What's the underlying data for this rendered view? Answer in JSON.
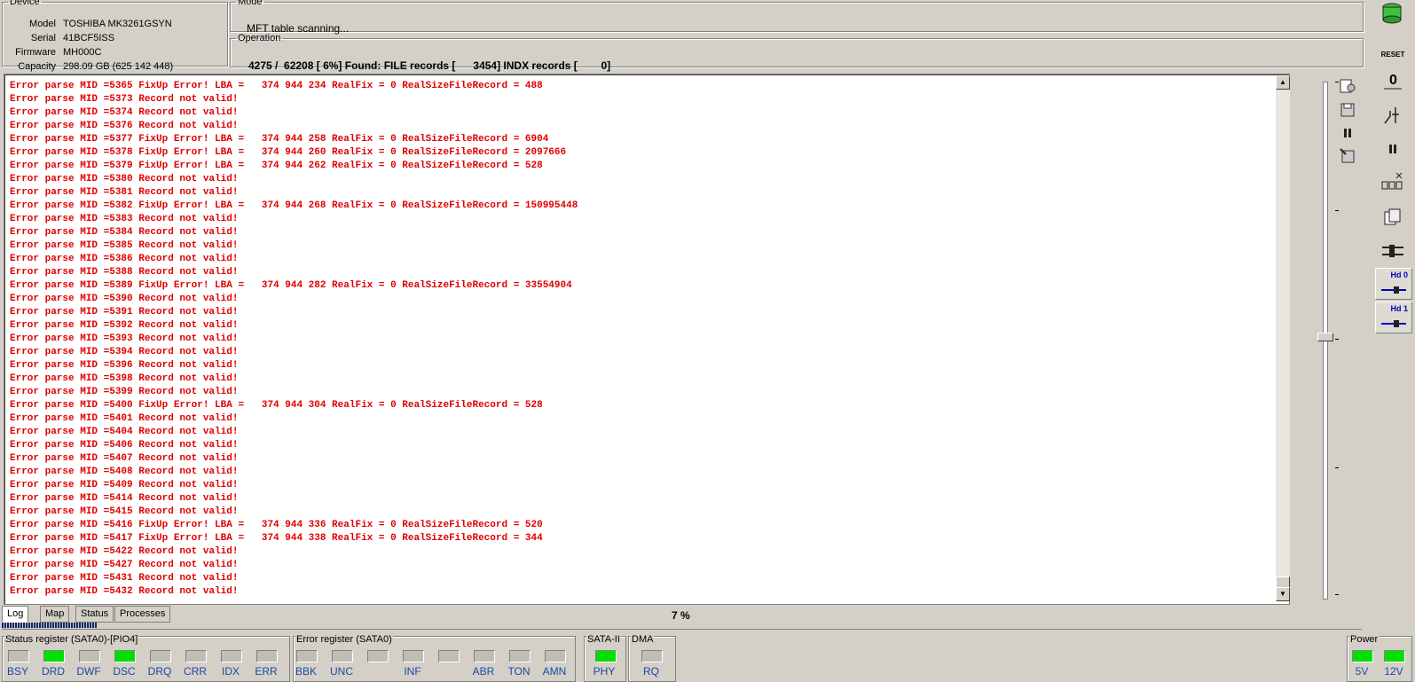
{
  "device": {
    "legend": "Device",
    "rows": [
      {
        "key": "Model",
        "value": "TOSHIBA MK3261GSYN"
      },
      {
        "key": "Serial",
        "value": "41BCF5ISS"
      },
      {
        "key": "Firmware",
        "value": "MH000C"
      },
      {
        "key": "Capacity",
        "value": "298.09 GB (625 142 448)"
      }
    ]
  },
  "mode": {
    "legend": "Mode",
    "text": "MFT table scanning..."
  },
  "operation": {
    "legend": "Operation",
    "text": "4275 /  62208 [ 6%] Found: FILE records [      3454] INDX records [        0]"
  },
  "log": [
    "Error parse MID =5365 FixUp Error! LBA =   374 944 234 RealFix = 0 RealSizeFileRecord = 488",
    "Error parse MID =5373 Record not valid!",
    "Error parse MID =5374 Record not valid!",
    "Error parse MID =5376 Record not valid!",
    "Error parse MID =5377 FixUp Error! LBA =   374 944 258 RealFix = 0 RealSizeFileRecord = 6904",
    "Error parse MID =5378 FixUp Error! LBA =   374 944 260 RealFix = 0 RealSizeFileRecord = 2097666",
    "Error parse MID =5379 FixUp Error! LBA =   374 944 262 RealFix = 0 RealSizeFileRecord = 528",
    "Error parse MID =5380 Record not valid!",
    "Error parse MID =5381 Record not valid!",
    "Error parse MID =5382 FixUp Error! LBA =   374 944 268 RealFix = 0 RealSizeFileRecord = 150995448",
    "Error parse MID =5383 Record not valid!",
    "Error parse MID =5384 Record not valid!",
    "Error parse MID =5385 Record not valid!",
    "Error parse MID =5386 Record not valid!",
    "Error parse MID =5388 Record not valid!",
    "Error parse MID =5389 FixUp Error! LBA =   374 944 282 RealFix = 0 RealSizeFileRecord = 33554904",
    "Error parse MID =5390 Record not valid!",
    "Error parse MID =5391 Record not valid!",
    "Error parse MID =5392 Record not valid!",
    "Error parse MID =5393 Record not valid!",
    "Error parse MID =5394 Record not valid!",
    "Error parse MID =5396 Record not valid!",
    "Error parse MID =5398 Record not valid!",
    "Error parse MID =5399 Record not valid!",
    "Error parse MID =5400 FixUp Error! LBA =   374 944 304 RealFix = 0 RealSizeFileRecord = 528",
    "Error parse MID =5401 Record not valid!",
    "Error parse MID =5404 Record not valid!",
    "Error parse MID =5406 Record not valid!",
    "Error parse MID =5407 Record not valid!",
    "Error parse MID =5408 Record not valid!",
    "Error parse MID =5409 Record not valid!",
    "Error parse MID =5414 Record not valid!",
    "Error parse MID =5415 Record not valid!",
    "Error parse MID =5416 FixUp Error! LBA =   374 944 336 RealFix = 0 RealSizeFileRecord = 520",
    "Error parse MID =5417 FixUp Error! LBA =   374 944 338 RealFix = 0 RealSizeFileRecord = 344",
    "Error parse MID =5422 Record not valid!",
    "Error parse MID =5427 Record not valid!",
    "Error parse MID =5431 Record not valid!",
    "Error parse MID =5432 Record not valid!"
  ],
  "tabs": [
    "Log",
    "Map",
    "Status",
    "Processes"
  ],
  "active_tab": "Log",
  "percent_text": "7 %",
  "progress": 0.07,
  "toolbar": {
    "reset_label": "RESET",
    "hd0_label": "Hd 0",
    "hd1_label": "Hd 1"
  },
  "status_register": {
    "title": "Status register (SATA0)-[PIO4]",
    "bits": [
      {
        "label": "BSY",
        "on": false
      },
      {
        "label": "DRD",
        "on": true
      },
      {
        "label": "DWF",
        "on": false
      },
      {
        "label": "DSC",
        "on": true
      },
      {
        "label": "DRQ",
        "on": false
      },
      {
        "label": "CRR",
        "on": false
      },
      {
        "label": "IDX",
        "on": false
      },
      {
        "label": "ERR",
        "on": false
      }
    ]
  },
  "error_register": {
    "title": "Error register (SATA0)",
    "bits": [
      {
        "label": "BBK",
        "on": false
      },
      {
        "label": "UNC",
        "on": false
      },
      {
        "label": "",
        "on": false
      },
      {
        "label": "INF",
        "on": false
      },
      {
        "label": "",
        "on": false
      },
      {
        "label": "ABR",
        "on": false
      },
      {
        "label": "TON",
        "on": false
      },
      {
        "label": "AMN",
        "on": false
      }
    ]
  },
  "sata": {
    "title": "SATA-II",
    "bits": [
      {
        "label": "PHY",
        "on": true
      }
    ]
  },
  "dma": {
    "title": "DMA",
    "bits": [
      {
        "label": "RQ",
        "on": false
      }
    ]
  },
  "power": {
    "title": "Power",
    "bits": [
      {
        "label": "5V",
        "on": true
      },
      {
        "label": "12V",
        "on": true
      }
    ]
  },
  "colors": {
    "log_text": "#e00000",
    "led_on": "#00e000",
    "led_off": "#c0bdb5",
    "label_blue": "#1a4aa0"
  }
}
